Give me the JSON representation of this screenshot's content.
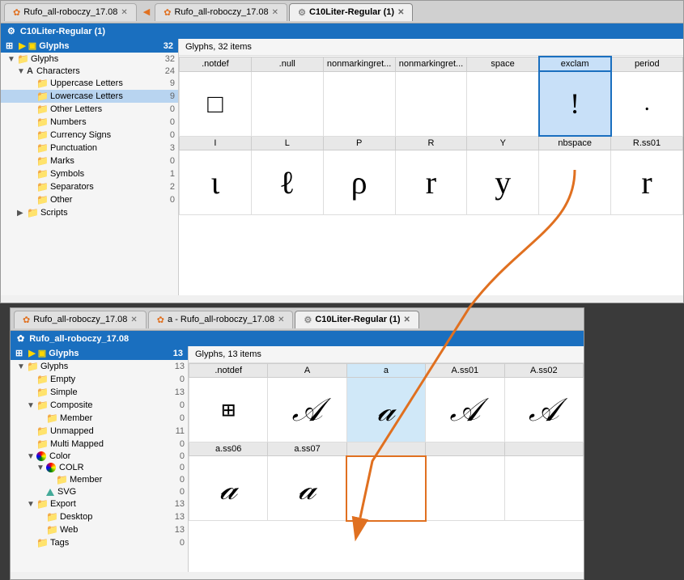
{
  "windows": {
    "top": {
      "tabs": [
        {
          "label": "Rufo_all-roboczy_17.08",
          "active": false,
          "icon": "orange"
        },
        {
          "label": "Rufo_all-roboczy_17.08",
          "active": false,
          "icon": "orange"
        },
        {
          "label": "C10Liter-Regular (1)",
          "active": true,
          "icon": "gear"
        }
      ],
      "title": "C10Liter-Regular (1)",
      "tree": {
        "header": {
          "label": "Glyphs",
          "count": "32"
        },
        "items": [
          {
            "label": "Glyphs",
            "count": "32",
            "indent": 1,
            "type": "glyphs",
            "expanded": true
          },
          {
            "label": "Characters",
            "count": "24",
            "indent": 2,
            "type": "characters",
            "expanded": true
          },
          {
            "label": "Uppercase Letters",
            "count": "9",
            "indent": 3,
            "type": "folder"
          },
          {
            "label": "Lowercase Letters",
            "count": "9",
            "indent": 3,
            "type": "folder"
          },
          {
            "label": "Other Letters",
            "count": "0",
            "indent": 3,
            "type": "folder"
          },
          {
            "label": "Numbers",
            "count": "0",
            "indent": 3,
            "type": "folder"
          },
          {
            "label": "Currency Signs",
            "count": "0",
            "indent": 3,
            "type": "folder"
          },
          {
            "label": "Punctuation",
            "count": "3",
            "indent": 3,
            "type": "folder"
          },
          {
            "label": "Marks",
            "count": "0",
            "indent": 3,
            "type": "folder"
          },
          {
            "label": "Symbols",
            "count": "1",
            "indent": 3,
            "type": "folder"
          },
          {
            "label": "Separators",
            "count": "2",
            "indent": 3,
            "type": "folder"
          },
          {
            "label": "Other",
            "count": "0",
            "indent": 3,
            "type": "folder"
          },
          {
            "label": "Scripts",
            "count": "",
            "indent": 2,
            "type": "scripts"
          }
        ]
      },
      "glyph_title": "Glyphs, 32 items",
      "glyph_headers": [
        ".notdef",
        ".null",
        "nonmarkingret...",
        "nonmarkingret...",
        "space",
        "exclam",
        "period"
      ],
      "glyph_headers2": [
        "I",
        "L",
        "P",
        "R",
        "Y",
        "nbspace",
        "R.ss01"
      ],
      "glyphs_row1": [
        "□",
        "",
        "",
        "",
        "",
        "!",
        "."
      ],
      "glyphs_row2": [
        "ɩ",
        "ℓ",
        "ρ",
        "r",
        "y",
        "",
        "r"
      ]
    },
    "bottom": {
      "tabs": [
        {
          "label": "Rufo_all-roboczy_17.08",
          "active": false,
          "icon": "orange"
        },
        {
          "label": "a - Rufo_all-roboczy_17.08",
          "active": false,
          "icon": "orange"
        },
        {
          "label": "C10Liter-Regular (1)",
          "active": true,
          "icon": "gear"
        }
      ],
      "title": "Rufo_all-roboczy_17.08",
      "tree": {
        "header": {
          "label": "Glyphs",
          "count": "13"
        },
        "items": [
          {
            "label": "Glyphs",
            "count": "13",
            "indent": 1,
            "type": "glyphs",
            "expanded": true
          },
          {
            "label": "Empty",
            "count": "0",
            "indent": 2,
            "type": "folder"
          },
          {
            "label": "Simple",
            "count": "13",
            "indent": 2,
            "type": "folder"
          },
          {
            "label": "Composite",
            "count": "0",
            "indent": 2,
            "type": "composite",
            "expanded": true
          },
          {
            "label": "Member",
            "count": "0",
            "indent": 3,
            "type": "folder"
          },
          {
            "label": "Unmapped",
            "count": "11",
            "indent": 2,
            "type": "folder"
          },
          {
            "label": "Multi Mapped",
            "count": "0",
            "indent": 2,
            "type": "folder"
          },
          {
            "label": "Color",
            "count": "0",
            "indent": 2,
            "type": "color",
            "expanded": true
          },
          {
            "label": "COLR",
            "count": "0",
            "indent": 3,
            "type": "colr",
            "expanded": true
          },
          {
            "label": "Member",
            "count": "0",
            "indent": 4,
            "type": "folder"
          },
          {
            "label": "SVG",
            "count": "0",
            "indent": 3,
            "type": "svg"
          },
          {
            "label": "Export",
            "count": "13",
            "indent": 2,
            "type": "export",
            "expanded": true
          },
          {
            "label": "Desktop",
            "count": "13",
            "indent": 3,
            "type": "folder"
          },
          {
            "label": "Web",
            "count": "13",
            "indent": 3,
            "type": "folder"
          },
          {
            "label": "Tags",
            "count": "0",
            "indent": 2,
            "type": "folder"
          }
        ]
      },
      "glyph_title": "Glyphs, 13 items",
      "glyph_headers": [
        ".notdef",
        "A",
        "a",
        "A.ss01",
        "A.ss02"
      ],
      "glyph_headers2": [
        "a.ss06",
        "a.ss07",
        "",
        "",
        ""
      ],
      "glyphs_row1_chars": [
        "⊞",
        "A",
        "a",
        "A",
        "A"
      ],
      "glyphs_row2_chars": [
        "a",
        "a",
        "",
        "",
        ""
      ]
    }
  },
  "arrow": {
    "color": "#e07020",
    "description": "Arrow pointing from exclam glyph in top window to empty cell in bottom window"
  }
}
